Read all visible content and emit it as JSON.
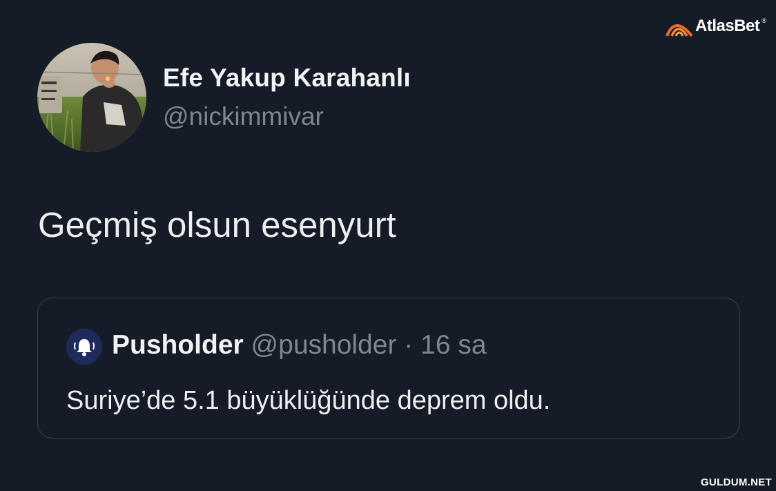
{
  "tweet": {
    "author_name": "Efe Yakup Karahanlı",
    "author_handle": "@nickimmivar",
    "text": "Geçmiş olsun esenyurt"
  },
  "quote": {
    "name": "Pusholder",
    "handle": "@pusholder",
    "separator": "·",
    "time": "16 sa",
    "text": "Suriye’de 5.1 büyüklüğünde deprem oldu."
  },
  "watermarks": {
    "brand": "AtlasBet",
    "brand_mark": "®",
    "site": "GULDUM.NET"
  },
  "icons": {
    "quote_avatar": "bell-icon",
    "brand_logo": "atlasbet-arc-icon"
  },
  "colors": {
    "background": "#161c27",
    "text_primary": "#eceef0",
    "text_secondary": "#7d8791",
    "card_border": "#39414c",
    "brand_orange": "#ee6a2a"
  }
}
